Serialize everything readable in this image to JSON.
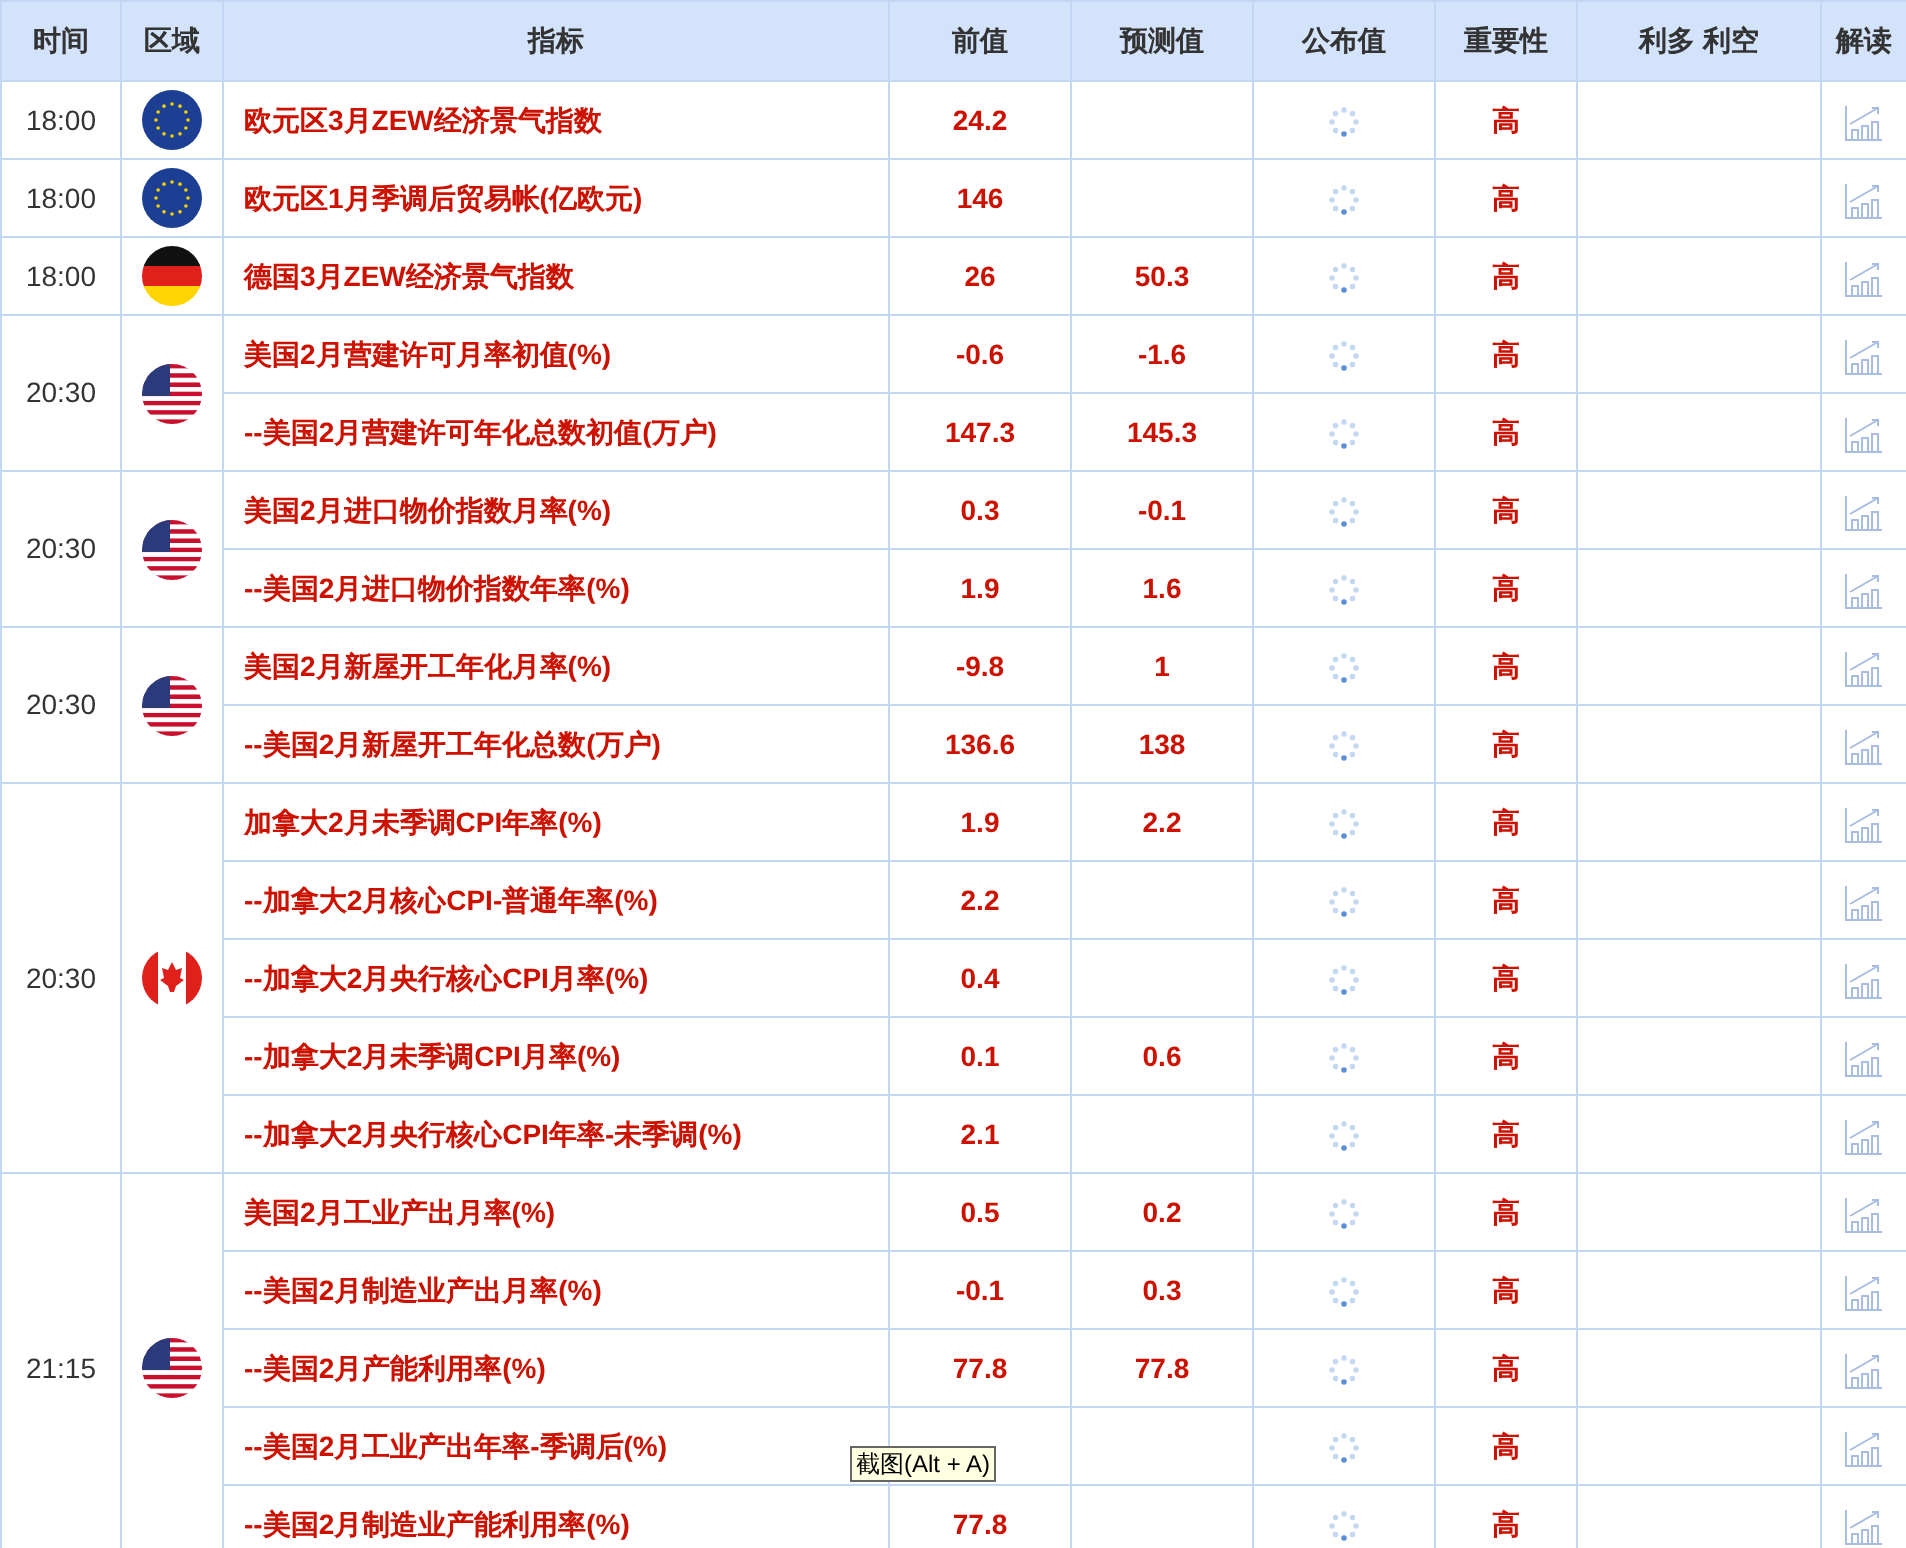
{
  "columns": [
    "时间",
    "区域",
    "指标",
    "前值",
    "预测值",
    "公布值",
    "重要性",
    "利多 利空",
    "解读"
  ],
  "groups": [
    {
      "time": "18:00",
      "kind": "eu",
      "rows": [
        {
          "indicator": "欧元区3月ZEW经济景气指数",
          "previous": "24.2",
          "importance": "高"
        }
      ]
    },
    {
      "time": "18:00",
      "kind": "eu",
      "rows": [
        {
          "indicator": "欧元区1月季调后贸易帐(亿欧元)",
          "previous": "146",
          "importance": "高"
        }
      ]
    },
    {
      "time": "18:00",
      "kind": "de",
      "rows": [
        {
          "indicator": "德国3月ZEW经济景气指数",
          "previous": "26",
          "forecast": "50.3",
          "importance": "高"
        }
      ]
    },
    {
      "time": "20:30",
      "kind": "us",
      "rows": [
        {
          "indicator": "美国2月营建许可月率初值(%)",
          "previous": "-0.6",
          "forecast": "-1.6",
          "importance": "高"
        },
        {
          "indicator": "--美国2月营建许可年化总数初值(万户)",
          "previous": "147.3",
          "forecast": "145.3",
          "importance": "高"
        }
      ]
    },
    {
      "time": "20:30",
      "kind": "us",
      "rows": [
        {
          "indicator": "美国2月进口物价指数月率(%)",
          "previous": "0.3",
          "forecast": "-0.1",
          "importance": "高"
        },
        {
          "indicator": "--美国2月进口物价指数年率(%)",
          "previous": "1.9",
          "forecast": "1.6",
          "importance": "高"
        }
      ]
    },
    {
      "time": "20:30",
      "kind": "us",
      "rows": [
        {
          "indicator": "美国2月新屋开工年化月率(%)",
          "previous": "-9.8",
          "forecast": "1",
          "importance": "高"
        },
        {
          "indicator": "--美国2月新屋开工年化总数(万户)",
          "previous": "136.6",
          "forecast": "138",
          "importance": "高"
        }
      ]
    },
    {
      "time": "20:30",
      "kind": "ca",
      "rows": [
        {
          "indicator": "加拿大2月未季调CPI年率(%)",
          "previous": "1.9",
          "forecast": "2.2",
          "importance": "高"
        },
        {
          "indicator": "--加拿大2月核心CPI-普通年率(%)",
          "previous": "2.2",
          "importance": "高"
        },
        {
          "indicator": "--加拿大2月央行核心CPI月率(%)",
          "previous": "0.4",
          "importance": "高"
        },
        {
          "indicator": "--加拿大2月未季调CPI月率(%)",
          "previous": "0.1",
          "forecast": "0.6",
          "importance": "高"
        },
        {
          "indicator": "--加拿大2月央行核心CPI年率-未季调(%)",
          "previous": "2.1",
          "importance": "高"
        }
      ]
    },
    {
      "time": "21:15",
      "kind": "us",
      "rows": [
        {
          "indicator": "美国2月工业产出月率(%)",
          "previous": "0.5",
          "forecast": "0.2",
          "importance": "高"
        },
        {
          "indicator": "--美国2月制造业产出月率(%)",
          "previous": "-0.1",
          "forecast": "0.3",
          "importance": "高"
        },
        {
          "indicator": "--美国2月产能利用率(%)",
          "previous": "77.8",
          "forecast": "77.8",
          "importance": "高"
        },
        {
          "indicator": "--美国2月工业产出年率-季调后(%)",
          "importance": "高"
        },
        {
          "indicator": "--美国2月制造业产能利用率(%)",
          "previous": "77.8",
          "importance": "高"
        }
      ]
    }
  ],
  "tooltip": "截图(Alt + A)"
}
